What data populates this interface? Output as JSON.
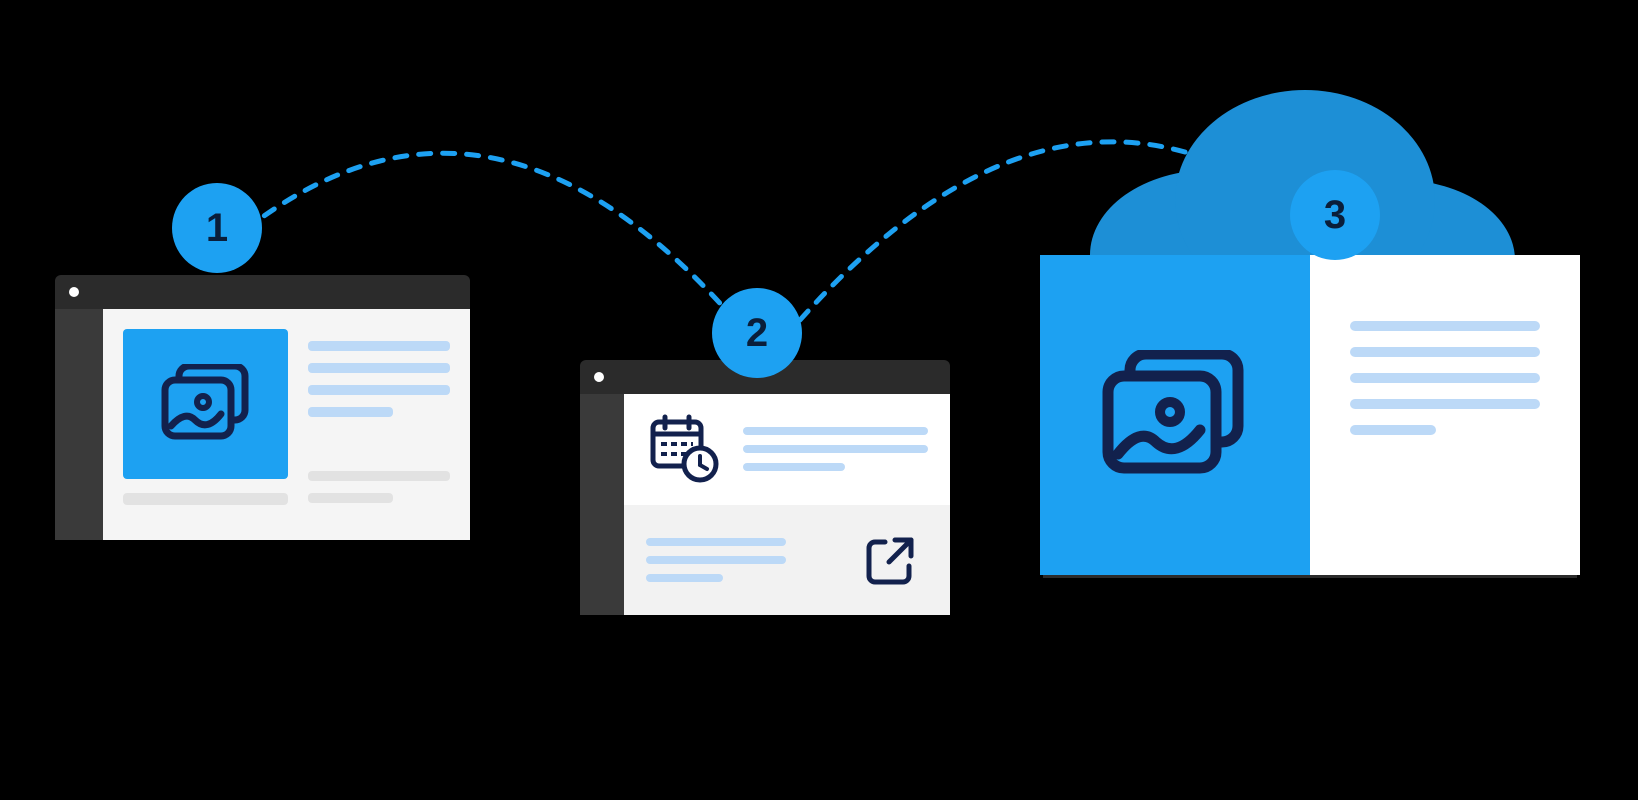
{
  "steps": {
    "one": {
      "label": "1",
      "icon": "gallery-icon"
    },
    "two": {
      "label": "2",
      "icons": [
        "calendar-clock-icon",
        "external-link-icon"
      ]
    },
    "three": {
      "label": "3",
      "icon": "gallery-icon",
      "background": "cloud-icon"
    }
  },
  "colors": {
    "accent": "#1da1f2",
    "dark": "#0a1e3a",
    "panel": "#2b2b2b",
    "line": "#bcd9f7"
  }
}
